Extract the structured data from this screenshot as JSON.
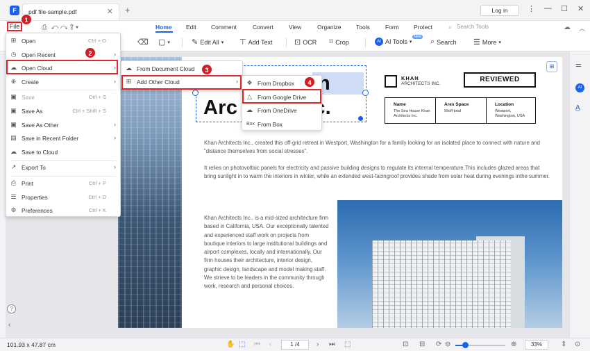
{
  "window": {
    "tab_name": "pdf file-sample.pdf",
    "login_label": "Log in"
  },
  "menu": {
    "file": "File",
    "items": [
      "Home",
      "Edit",
      "Comment",
      "Convert",
      "View",
      "Organize",
      "Tools",
      "Form",
      "Protect"
    ],
    "search_tools": "Search Tools"
  },
  "toolbar": {
    "edit_all": "Edit All",
    "add_text": "Add Text",
    "ocr": "OCR",
    "crop": "Crop",
    "ai_tools": "AI Tools",
    "search": "Search",
    "more": "More",
    "new_badge": "New"
  },
  "file_menu": [
    {
      "icon": "open-icon",
      "label": "Open",
      "shortcut": "Ctrl + O",
      "arrow": false,
      "disabled": false
    },
    {
      "icon": "clock-icon",
      "label": "Open Recent",
      "shortcut": "",
      "arrow": true,
      "disabled": false
    },
    {
      "icon": "cloud-icon",
      "label": "Open Cloud",
      "shortcut": "",
      "arrow": true,
      "disabled": false
    },
    {
      "icon": "create-icon",
      "label": "Create",
      "shortcut": "",
      "arrow": true,
      "disabled": false
    },
    {
      "icon": "save-icon",
      "label": "Save",
      "shortcut": "Ctrl + S",
      "arrow": false,
      "disabled": true
    },
    {
      "icon": "save-as-icon",
      "label": "Save As",
      "shortcut": "Ctrl + Shift + S",
      "arrow": false,
      "disabled": false
    },
    {
      "icon": "save-as-other-icon",
      "label": "Save As Other",
      "shortcut": "",
      "arrow": true,
      "disabled": false
    },
    {
      "icon": "recent-folder-icon",
      "label": "Save in Recent Folder",
      "shortcut": "",
      "arrow": true,
      "disabled": false
    },
    {
      "icon": "save-cloud-icon",
      "label": "Save to Cloud",
      "shortcut": "",
      "arrow": false,
      "disabled": false
    },
    {
      "icon": "export-icon",
      "label": "Export To",
      "shortcut": "",
      "arrow": true,
      "disabled": false
    },
    {
      "icon": "print-icon",
      "label": "Print",
      "shortcut": "Ctrl + P",
      "arrow": false,
      "disabled": false
    },
    {
      "icon": "properties-icon",
      "label": "Properties",
      "shortcut": "Ctrl + D",
      "arrow": false,
      "disabled": false
    },
    {
      "icon": "preferences-icon",
      "label": "Preferences",
      "shortcut": "Ctrl + K",
      "arrow": false,
      "disabled": false
    }
  ],
  "cloud_menu": [
    "From Document Cloud",
    "Add Other Cloud"
  ],
  "other_cloud_menu": [
    {
      "icon": "dropbox-icon",
      "label": "From Dropbox"
    },
    {
      "icon": "google-drive-icon",
      "label": "From Google Drive"
    },
    {
      "icon": "onedrive-icon",
      "label": "From OneDrive"
    },
    {
      "icon": "box-icon",
      "label": "From Box",
      "icon_text": "Box"
    }
  ],
  "step_badges": [
    "1",
    "2",
    "3",
    "4"
  ],
  "document": {
    "title_part1": "Arc",
    "title_part2": "Inc.",
    "title_top_right": "n",
    "logo_line1": "KHAN",
    "logo_line2": "ARCHITECTS INC.",
    "reviewed": "REVIEWED",
    "table": [
      {
        "head": "Name",
        "value": "The Sea House Khan Architects Inc."
      },
      {
        "head": "Ares Space",
        "value": "99off total"
      },
      {
        "head": "Location",
        "value": "Westport, Washington, USA"
      }
    ],
    "para1": "Khan Architects Inc., created this off-grid retreat in Westport, Washington for a family looking for an isolated place to connect with nature and \"distance themselves from social stresses\".",
    "para2": "It relies on photovoltaic panels for electricity and passive building designs to regulate its internal temperature.This includes glazed areas that bring sunlight in to warm the interiors in winter, while an extended west-facingroof provides shade from solar heat during evenings inthe summer.",
    "para3": "Khan Architects Inc., is a mid-sized architecture firm based in California, USA. Our exceptionally talented and experienced staff work on projects from boutique interiors to large institutional buildings and airport complexes, locally and internationally. Our firm houses their architecture, interior design, graphic design, landscape and model making staff. We strieve to be leaders in the community through work, research and personal choices."
  },
  "status": {
    "dimensions": "101.93 x 47.87 cm",
    "page": "1 /4",
    "zoom": "33%",
    "zoom_level_fraction": 0.2
  }
}
